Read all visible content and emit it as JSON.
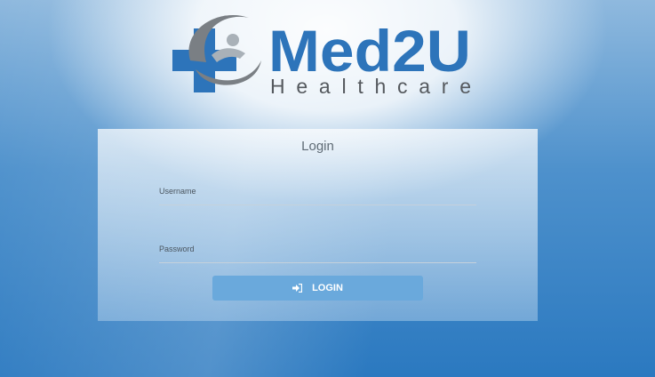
{
  "brand": {
    "name": "Med2U",
    "tagline": "Healthcare",
    "colors": {
      "primary": "#2d74ba",
      "tagline": "#55595e",
      "swoosh": "#7a7f84"
    }
  },
  "login": {
    "title": "Login",
    "username_label": "Username",
    "username_value": "",
    "password_label": "Password",
    "password_value": "",
    "button_label": "LOGIN",
    "button_icon": "sign-in-icon"
  }
}
